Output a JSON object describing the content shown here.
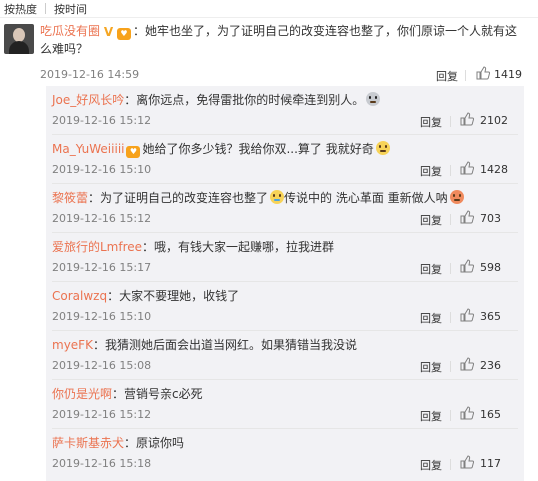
{
  "sort_tabs": [
    "按热度",
    "按时间"
  ],
  "main_comment": {
    "username": "吃瓜没有圈",
    "text": "：她牢也坐了，为了证明自己的改变连容也整了，你们原谅一个人就有这么难吗？",
    "time": "2019-12-16 14:59",
    "reply_label": "回复",
    "likes": "1419"
  },
  "replies": [
    {
      "username": "Joe_好风长吟",
      "text": "：离你远点，免得雷批你的时候牵连到别人。",
      "emoji": "cool-face-emoji",
      "time": "2019-12-16 15:12",
      "reply_label": "回复",
      "likes": "2102"
    },
    {
      "username": "Ma_YuWeiiiii",
      "level_badge": true,
      "text": "她给了你多少钱？我给你双...算了 我就好奇",
      "emoji": "thinking-face-emoji",
      "time": "2019-12-16 15:10",
      "reply_label": "回复",
      "likes": "1428"
    },
    {
      "username": "黎筱蕾",
      "text": "：为了证明自己的改变连容也整了",
      "emoji_mid": "laughing-tears-emoji",
      "text2": "传说中的 洗心革面 重新做人呐",
      "emoji": "angry-face-emoji",
      "time": "2019-12-16 15:12",
      "reply_label": "回复",
      "likes": "703"
    },
    {
      "username": "爱旅行的Lmfree",
      "text": "：哦，有钱大家一起赚哪，拉我进群",
      "time": "2019-12-16 15:17",
      "reply_label": "回复",
      "likes": "598"
    },
    {
      "username": "Coralwzq",
      "text": "：大家不要理她，收钱了",
      "time": "2019-12-16 15:10",
      "reply_label": "回复",
      "likes": "365"
    },
    {
      "username": "myeFK",
      "text": "：我猜测她后面会出道当网红。如果猜错当我没说",
      "time": "2019-12-16 15:08",
      "reply_label": "回复",
      "likes": "236"
    },
    {
      "username": "你仍是光啊",
      "text": "：营销号亲c必死",
      "time": "2019-12-16 15:12",
      "reply_label": "回复",
      "likes": "165"
    },
    {
      "username": "萨卡斯基赤犬",
      "text": "：原谅你吗",
      "time": "2019-12-16 15:18",
      "reply_label": "回复",
      "likes": "117"
    }
  ],
  "colors": {
    "username": "#eb7350",
    "time": "#808080",
    "reply_bg": "#f2f2f5"
  }
}
